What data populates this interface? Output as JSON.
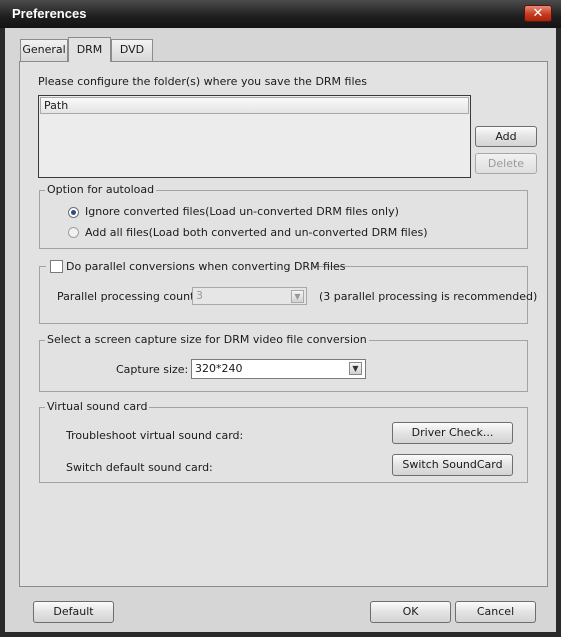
{
  "window": {
    "title": "Preferences",
    "close_symbol": "✕"
  },
  "tabs": [
    {
      "label": "General"
    },
    {
      "label": "DRM",
      "active": true
    },
    {
      "label": "DVD"
    }
  ],
  "drm": {
    "folder_prompt": "Please configure the folder(s) where you save the DRM files",
    "list": {
      "column_header": "Path",
      "rows": []
    },
    "add_button": "Add",
    "delete_button": "Delete",
    "autoload": {
      "title": "Option for autoload",
      "options": [
        {
          "label": "Ignore converted files(Load un-converted DRM files only)",
          "selected": true
        },
        {
          "label": "Add all files(Load both converted and un-converted DRM files)",
          "selected": false
        }
      ]
    },
    "parallel": {
      "checkbox_label": "Do parallel conversions when converting DRM files",
      "checked": false,
      "count_label": "Parallel processing count:",
      "count_value": "3",
      "recommendation": "(3 parallel processing is recommended)"
    },
    "capture": {
      "title": "Select a screen capture size for DRM video file conversion",
      "label": "Capture size:",
      "value": "320*240"
    },
    "sound": {
      "title": "Virtual sound card",
      "troubleshoot_label": "Troubleshoot virtual sound card:",
      "driver_check_button": "Driver Check...",
      "switch_label": "Switch default sound card:",
      "switch_button": "Switch SoundCard"
    }
  },
  "footer": {
    "default_button": "Default",
    "ok_button": "OK",
    "cancel_button": "Cancel"
  }
}
